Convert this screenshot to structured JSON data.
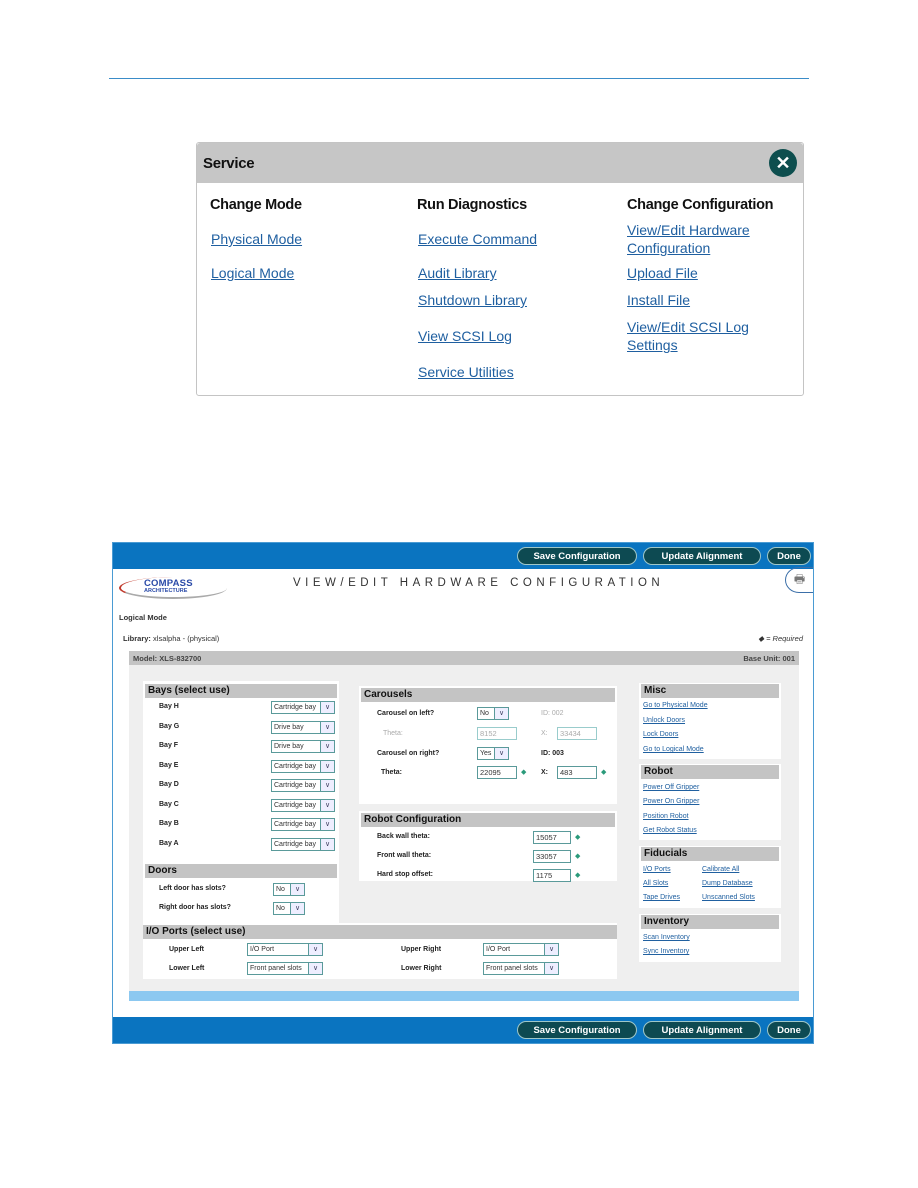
{
  "service_dialog": {
    "title": "Service",
    "close_icon": "close-x-icon",
    "columns": [
      {
        "heading": "Change Mode",
        "links": [
          "Physical Mode",
          "Logical Mode"
        ]
      },
      {
        "heading": "Run Diagnostics",
        "links": [
          "Execute Command",
          "Audit Library",
          "Shutdown Library",
          "View SCSI Log",
          "Service Utilities"
        ]
      },
      {
        "heading": "Change Configuration",
        "links": [
          {
            "line1": "View/Edit Hardware",
            "line2": "Configuration"
          },
          {
            "line1": "Upload File"
          },
          {
            "line1": "Install File"
          },
          {
            "line1": "View/Edit SCSI Log",
            "line2": "Settings"
          }
        ]
      }
    ]
  },
  "hardware_config": {
    "toolbar": {
      "save_label": "Save Configuration",
      "update_label": "Update Alignment",
      "done_label": "Done"
    },
    "logo": {
      "line1": "COMPASS",
      "line2": "ARCHITECTURE"
    },
    "title": "VIEW/EDIT HARDWARE CONFIGURATION",
    "printer_icon": "printer-icon",
    "mode": "Logical Mode",
    "library_label": "Library:",
    "library_value": "xlsalpha - (physical)",
    "required_legend": "◆ = Required",
    "model": "Model: XLS-832700",
    "base_unit": "Base Unit: 001",
    "bays": {
      "heading": "Bays (select use)",
      "rows": [
        {
          "label": "Bay H",
          "value": "Cartridge bay"
        },
        {
          "label": "Bay G",
          "value": "Drive bay"
        },
        {
          "label": "Bay F",
          "value": "Drive bay"
        },
        {
          "label": "Bay E",
          "value": "Cartridge bay"
        },
        {
          "label": "Bay D",
          "value": "Cartridge bay"
        },
        {
          "label": "Bay C",
          "value": "Cartridge bay"
        },
        {
          "label": "Bay B",
          "value": "Cartridge bay"
        },
        {
          "label": "Bay A",
          "value": "Cartridge bay"
        }
      ]
    },
    "doors": {
      "heading": "Doors",
      "rows": [
        {
          "label": "Left door has slots?",
          "value": "No"
        },
        {
          "label": "Right door has slots?",
          "value": "No"
        }
      ]
    },
    "carousels": {
      "heading": "Carousels",
      "left_label": "Carousel on left?",
      "left_value": "No",
      "left_id": "ID: 002",
      "left_theta_label": "Theta:",
      "left_theta": "8152",
      "left_x_label": "X:",
      "left_x": "33434",
      "right_label": "Carousel on right?",
      "right_value": "Yes",
      "right_id": "ID: 003",
      "right_theta_label": "Theta:",
      "right_theta": "22095",
      "right_x_label": "X:",
      "right_x": "483"
    },
    "robot_config": {
      "heading": "Robot Configuration",
      "rows": [
        {
          "label": "Back wall theta:",
          "value": "15057"
        },
        {
          "label": "Front wall theta:",
          "value": "33057"
        },
        {
          "label": "Hard stop offset:",
          "value": "1175"
        }
      ]
    },
    "io_ports": {
      "heading": "I/O Ports (select use)",
      "upper_left_label": "Upper Left",
      "upper_left": "I/O Port",
      "lower_left_label": "Lower Left",
      "lower_left": "Front panel slots",
      "upper_right_label": "Upper Right",
      "upper_right": "I/O Port",
      "lower_right_label": "Lower Right",
      "lower_right": "Front panel slots"
    },
    "misc": {
      "heading": "Misc",
      "links": [
        "Go to Physical Mode",
        "Unlock Doors",
        "Lock Doors",
        "Go to Logical Mode"
      ]
    },
    "robot": {
      "heading": "Robot",
      "links": [
        "Power Off Gripper",
        "Power On Gripper",
        "Position Robot",
        "Get Robot Status"
      ]
    },
    "fiducials": {
      "heading": "Fiducials",
      "links": [
        "I/O Ports",
        "Calibrate All",
        "All Slots",
        "Dump Database",
        "Tape Drives",
        "Unscanned Slots"
      ]
    },
    "inventory": {
      "heading": "Inventory",
      "links": [
        "Scan Inventory",
        "Sync Inventory"
      ]
    }
  }
}
